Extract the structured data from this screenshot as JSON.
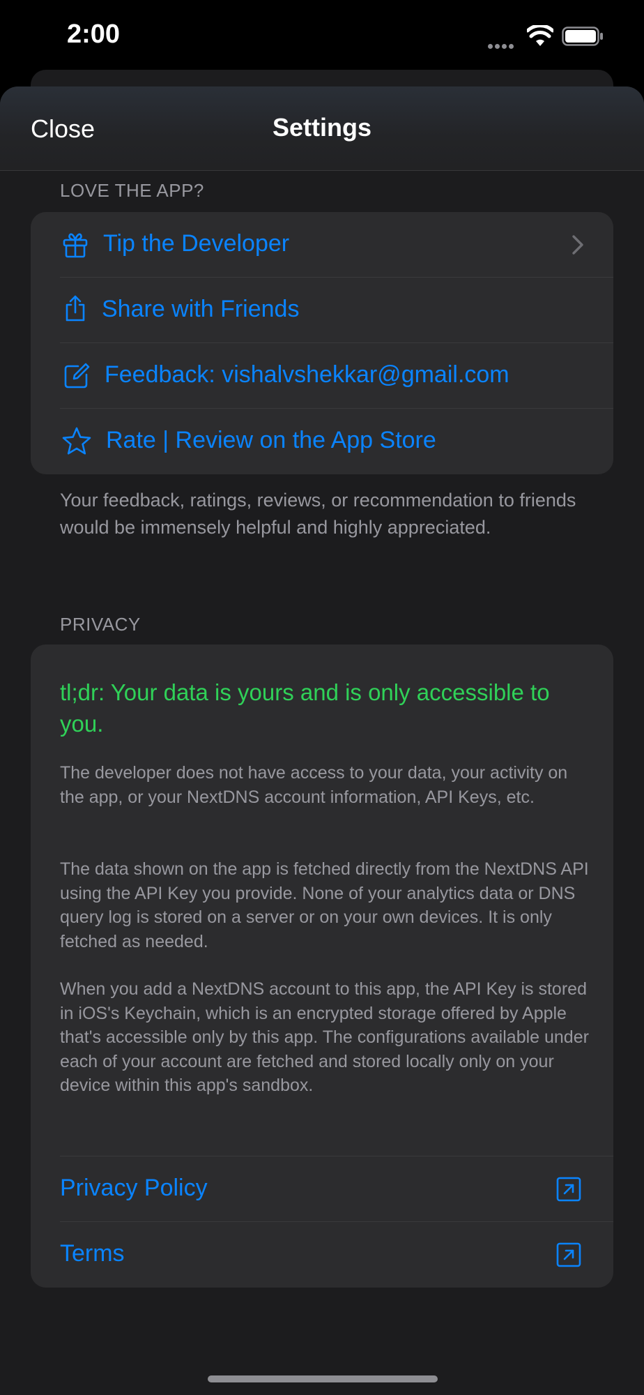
{
  "status_bar": {
    "time": "2:00"
  },
  "nav": {
    "close_label": "Close",
    "title": "Settings"
  },
  "love_section": {
    "header": "LOVE THE APP?",
    "items": [
      {
        "label": "Tip the Developer",
        "icon": "gift-icon",
        "accessory": "chevron"
      },
      {
        "label": "Share with Friends",
        "icon": "share-icon"
      },
      {
        "label": "Feedback: vishalvshekkar@gmail.com",
        "icon": "compose-icon"
      },
      {
        "label": "Rate | Review on the App Store",
        "icon": "star-icon"
      }
    ],
    "footer": "Your feedback, ratings, reviews, or recommendation to friends would be immensely helpful and highly appreciated."
  },
  "privacy_section": {
    "header": "PRIVACY",
    "headline": "tl;dr: Your data is yours and is only accessible to you.",
    "paragraphs": [
      "The developer does not have access to your data, your activity on the app, or your NextDNS account information, API Keys, etc.",
      "The data shown on the app is fetched directly from the NextDNS API using the API Key you provide. None of your analytics data or DNS query log is stored on a server or on your own devices. It is only fetched as needed.",
      "When you add a NextDNS account to this app, the API Key is stored in iOS's Keychain, which is an encrypted storage offered by Apple that's accessible only by this app. The configurations available under each of your account are fetched and stored locally only on your device within this app's sandbox."
    ],
    "links": [
      {
        "label": "Privacy Policy",
        "icon": "external-link-icon"
      },
      {
        "label": "Terms",
        "icon": "external-link-icon"
      }
    ]
  },
  "colors": {
    "accent": "#0a84ff",
    "success": "#30d158",
    "secondary_text": "#98989f",
    "group_bg": "#2c2c2e",
    "sheet_bg": "#1c1c1e"
  }
}
